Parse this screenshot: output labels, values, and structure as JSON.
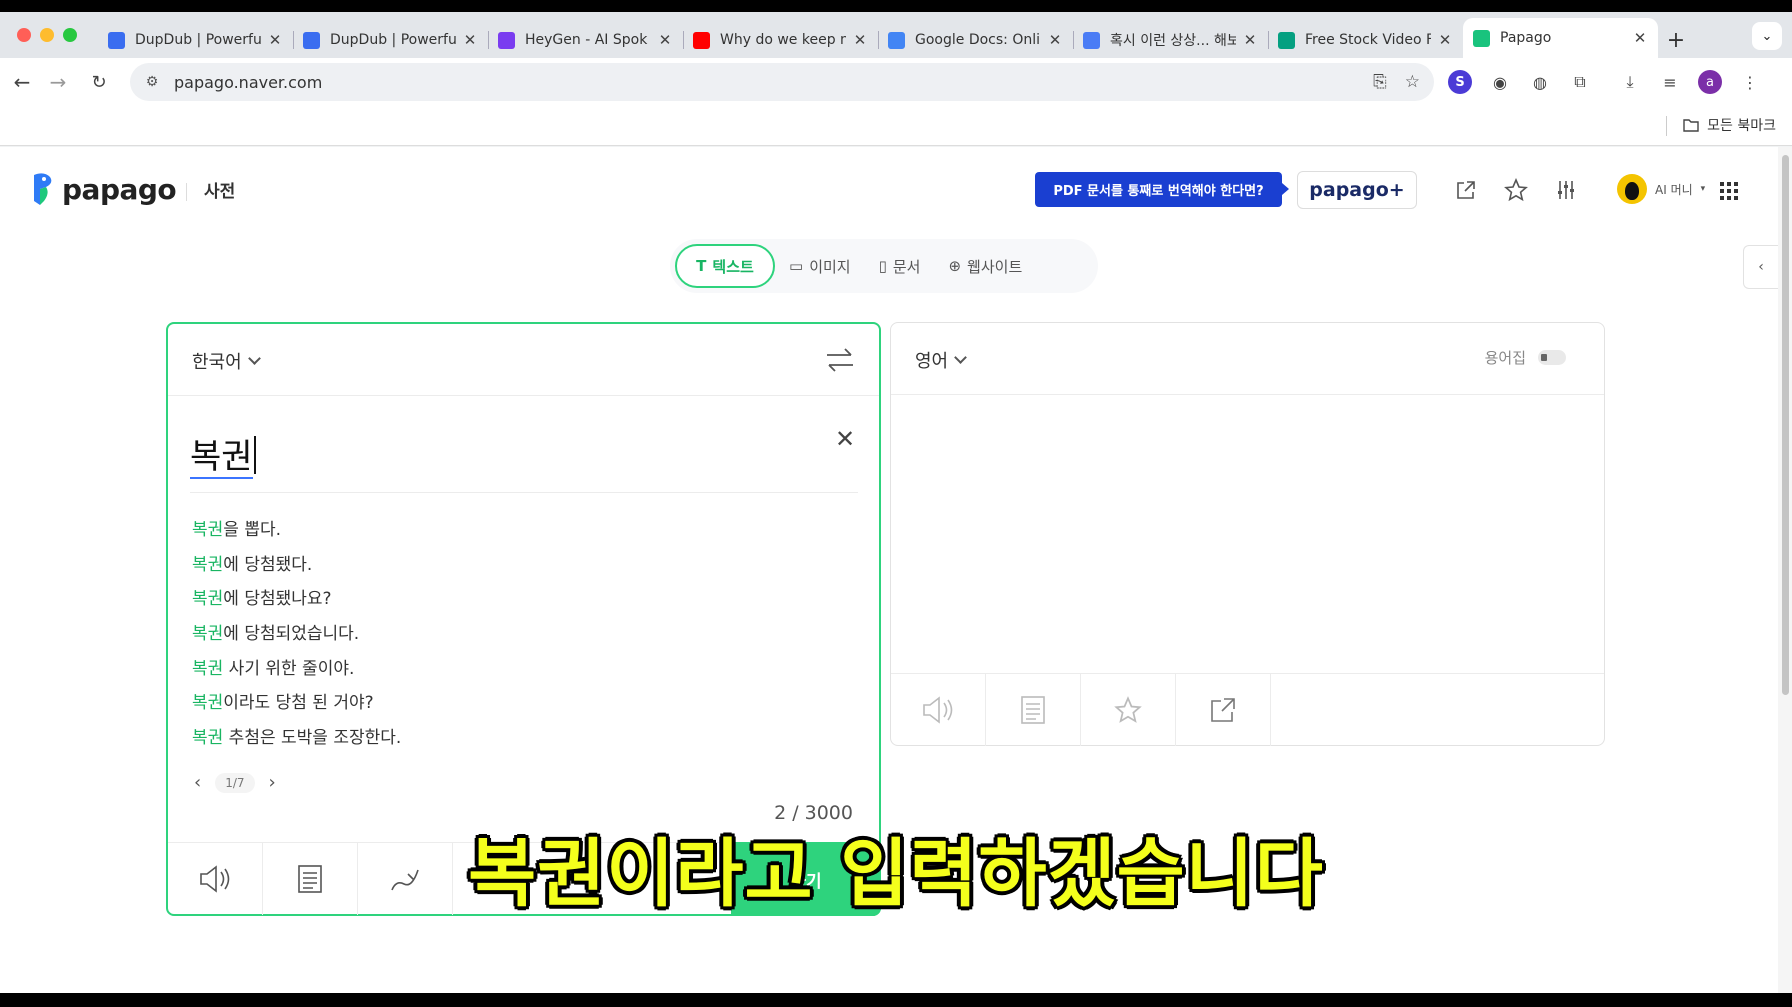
{
  "browser": {
    "tabs": [
      {
        "title": "DupDub | Powerfu",
        "favicon": "dupdub-icon",
        "color": "#3a6df0",
        "active": false
      },
      {
        "title": "DupDub | Powerfu",
        "favicon": "dupdub-icon",
        "color": "#3a6df0",
        "active": false
      },
      {
        "title": "HeyGen - AI Spok",
        "favicon": "heygen-icon",
        "color": "#7a3cf0",
        "active": false
      },
      {
        "title": "Why do we keep n",
        "favicon": "youtube-icon",
        "color": "#ff0000",
        "active": false
      },
      {
        "title": "Google Docs: Onli",
        "favicon": "google-icon",
        "color": "#4285f4",
        "active": false
      },
      {
        "title": "혹시 이런 상상... 해보",
        "favicon": "docs-icon",
        "color": "#4a7cf5",
        "active": false
      },
      {
        "title": "Free Stock Video F",
        "favicon": "pexels-icon",
        "color": "#05a081",
        "active": false
      },
      {
        "title": "Papago",
        "favicon": "papago-icon",
        "color": "#19c37d",
        "active": true
      }
    ],
    "url": "papago.naver.com",
    "bookmarks_all": "모든 북마크"
  },
  "header": {
    "logo_text": "papago",
    "dict_label": "사전",
    "pdf_banner": "PDF 문서를 통째로 번역해야 한다면?",
    "plus_label": "papago+",
    "user_name": "AI 머니"
  },
  "modes": [
    {
      "label": "텍스트",
      "icon": "text-icon",
      "active": true
    },
    {
      "label": "이미지",
      "icon": "image-icon",
      "active": false
    },
    {
      "label": "문서",
      "icon": "document-icon",
      "active": false
    },
    {
      "label": "웹사이트",
      "icon": "globe-icon",
      "active": false
    }
  ],
  "source": {
    "language": "한국어",
    "text": "복권",
    "suggestions": [
      {
        "keyword": "복권",
        "rest": "을 뽑다."
      },
      {
        "keyword": "복권",
        "rest": "에 당첨됐다."
      },
      {
        "keyword": "복권",
        "rest": "에 당첨됐나요?"
      },
      {
        "keyword": "복권",
        "rest": "에 당첨되었습니다."
      },
      {
        "keyword": "복권",
        "rest": " 사기 위한 줄이야."
      },
      {
        "keyword": "복권",
        "rest": "이라도 당첨 된 거야?"
      },
      {
        "keyword": "복권",
        "rest": " 추첨은 도박을 조장한다."
      }
    ],
    "page": "1/7",
    "char_count": "2 / 3000",
    "translate_label": "하기"
  },
  "target": {
    "language": "영어",
    "glossary_label": "용어집"
  },
  "subtitle": "복권이라고 입력하겠습니다",
  "colors": {
    "accent_green": "#2ed37d",
    "keyword_green": "#19b562",
    "banner_blue": "#1a3fd1",
    "subtitle_yellow": "#f4ff1c"
  }
}
